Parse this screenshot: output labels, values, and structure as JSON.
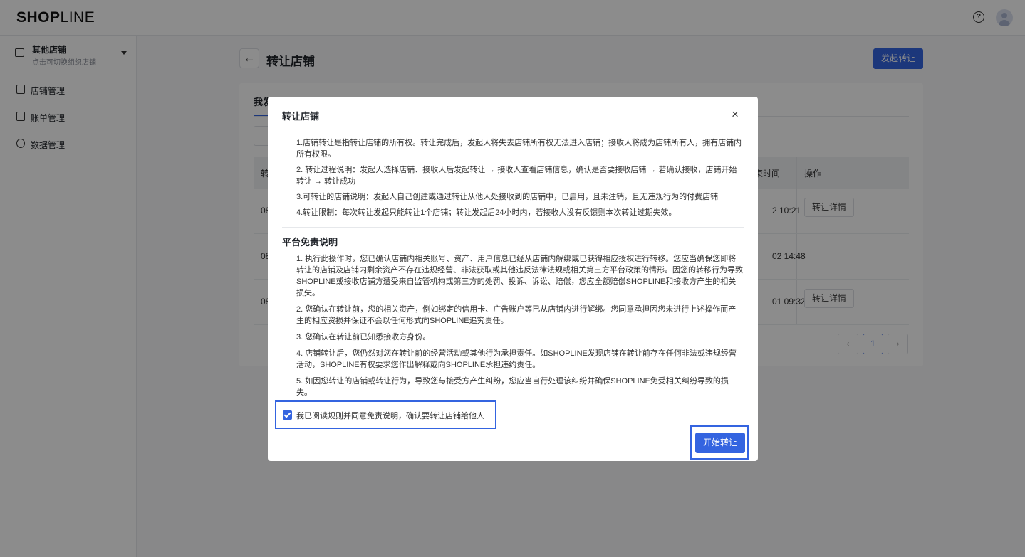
{
  "header": {
    "logo_bold": "SHOP",
    "logo_thin": "LINE",
    "help_glyph": "?"
  },
  "sidebar": {
    "store_name": "其他店铺",
    "store_hint": "点击可切换组织店铺",
    "items": [
      {
        "label": "店铺管理",
        "icon": "store-icon"
      },
      {
        "label": "账单管理",
        "icon": "bill-icon"
      },
      {
        "label": "数据管理",
        "icon": "gauge-icon"
      }
    ]
  },
  "main": {
    "back_glyph": "←",
    "title": "转让店铺",
    "initiate_button": "发起转让",
    "tab_active": "我发",
    "table": {
      "col_first": "转",
      "col_end_time": "束时间",
      "col_action": "操作",
      "rows": [
        {
          "id": "08",
          "time": "2 10:21",
          "action": "转让详情"
        },
        {
          "id": "08",
          "time": "02 14:48",
          "action": ""
        },
        {
          "id": "08",
          "time": "01 09:32",
          "action": "转让详情"
        }
      ]
    },
    "pager": {
      "prev": "‹",
      "current": "1",
      "next": "›"
    }
  },
  "modal": {
    "title": "转让店铺",
    "close_glyph": "×",
    "rules": [
      "1.店铺转让是指转让店铺的所有权。转让完成后，发起人将失去店铺所有权无法进入店铺；接收人将成为店铺所有人，拥有店铺内所有权限。",
      "2. 转让过程说明：发起人选择店铺、接收人后发起转让 → 接收人查看店铺信息，确认是否要接收店铺 → 若确认接收，店铺开始转让 → 转让成功",
      "3.可转让的店铺说明：发起人自己创建或通过转让从他人处接收到的店铺中，已启用，且未注销，且无违规行为的付费店铺",
      "4.转让限制：每次转让发起只能转让1个店铺；转让发起后24小时内，若接收人没有反馈则本次转让过期失效。"
    ],
    "disclaimer_title": "平台免责说明",
    "disclaimer": [
      "1. 执行此操作时，您已确认店铺内相关账号、资产、用户信息已经从店铺内解绑或已获得相应授权进行转移。您应当确保您即将转让的店铺及店铺内剩余资产不存在违规经营、非法获取或其他违反法律法规或相关第三方平台政策的情形。因您的转移行为导致SHOPLINE或接收店铺方遭受来自监管机构或第三方的处罚、投诉、诉讼、赔偿，您应全额赔偿SHOPLINE和接收方产生的相关损失。",
      "2. 您确认在转让前，您的相关资产，例如绑定的信用卡、广告账户等已从店铺内进行解绑。您同意承担因您未进行上述操作而产生的相应资损并保证不会以任何形式向SHOPLINE追究责任。",
      "3. 您确认在转让前已知悉接收方身份。",
      "4. 店铺转让后，您仍然对您在转让前的经营活动或其他行为承担责任。如SHOPLINE发现店铺在转让前存在任何非法或违规经营活动，SHOPLINE有权要求您作出解释或向SHOPLINE承担违约责任。",
      "5. 如因您转让的店铺或转让行为，导致您与接受方产生纠纷，您应当自行处理该纠纷并确保SHOPLINE免受相关纠纷导致的损失。"
    ],
    "agree_label": "我已阅读规则并同意免责说明，确认要转让店铺给他人",
    "agree_checked": true,
    "start_button": "开始转让"
  },
  "colors": {
    "accent": "#3464e0",
    "mask": "rgba(0,0,0,0.45)"
  }
}
